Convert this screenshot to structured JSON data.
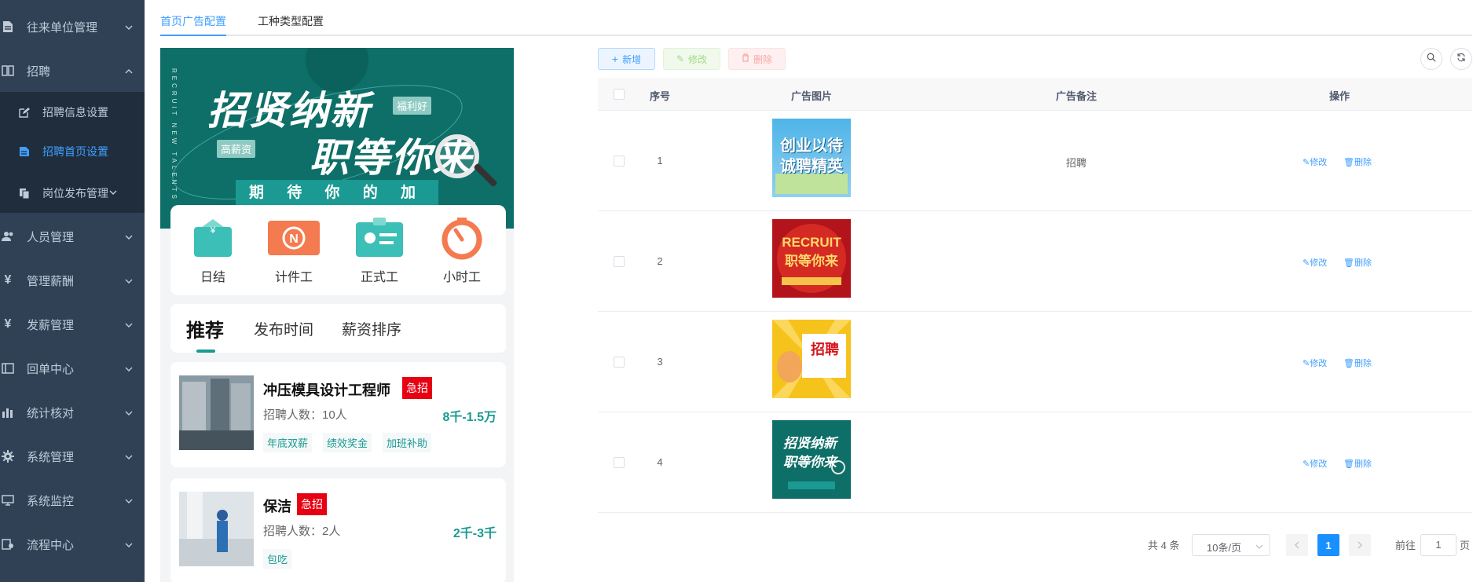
{
  "sidebar": {
    "items": [
      {
        "label": "往来单位管理"
      },
      {
        "label": "招聘"
      },
      {
        "label": "人员管理"
      },
      {
        "label": "管理薪酬"
      },
      {
        "label": "发薪管理"
      },
      {
        "label": "回单中心"
      },
      {
        "label": "统计核对"
      },
      {
        "label": "系统管理"
      },
      {
        "label": "系统监控"
      },
      {
        "label": "流程中心"
      }
    ],
    "sub_items": [
      {
        "label": "招聘信息设置"
      },
      {
        "label": "招聘首页设置"
      },
      {
        "label": "岗位发布管理"
      }
    ]
  },
  "tabs": [
    {
      "label": "首页广告配置"
    },
    {
      "label": "工种类型配置"
    }
  ],
  "preview": {
    "banner": {
      "line1": "招贤纳新",
      "line2": "职等你来",
      "tag1": "福利好",
      "tag2": "高薪资",
      "stripe": "期 待 你 的 加 入 !",
      "side_text": "RECRUIT NEW TALENTS"
    },
    "categories": [
      {
        "label": "日结",
        "icon": "wallet-icon"
      },
      {
        "label": "计件工",
        "icon": "piece-icon"
      },
      {
        "label": "正式工",
        "icon": "badge-icon"
      },
      {
        "label": "小时工",
        "icon": "stopwatch-icon"
      }
    ],
    "sort_tabs": [
      {
        "label": "推荐"
      },
      {
        "label": "发布时间"
      },
      {
        "label": "薪资排序"
      }
    ],
    "jobs": [
      {
        "title": "冲压模具设计工程师",
        "urgent": "急招",
        "count": "招聘人数：10人",
        "salary": "8千-1.5万",
        "tags": [
          "年底双薪",
          "绩效奖金",
          "加班补助"
        ]
      },
      {
        "title": "保洁",
        "urgent": "急招",
        "count": "招聘人数：2人",
        "salary": "2千-3千",
        "tags": [
          "包吃"
        ]
      }
    ]
  },
  "toolbar": {
    "add_label": "新增",
    "edit_label": "修改",
    "delete_label": "删除"
  },
  "table": {
    "columns": [
      "序号",
      "广告图片",
      "广告备注",
      "操作"
    ],
    "rows": [
      {
        "index": "1",
        "note": "招聘",
        "image": "创业以待 诚聘精英"
      },
      {
        "index": "2",
        "note": "",
        "image": "RECRUIT 职等你来"
      },
      {
        "index": "3",
        "note": "",
        "image": "招聘"
      },
      {
        "index": "4",
        "note": "",
        "image": "招贤纳新 职等你来"
      }
    ],
    "edit_action": "修改",
    "delete_action": "删除"
  },
  "pagination": {
    "total": "共 4 条",
    "page_size": "10条/页",
    "current": "1",
    "goto_label": "前往",
    "goto_value": "1",
    "page_suffix": "页"
  },
  "colors": {
    "sidebar": "#304156",
    "accent": "#409eff",
    "teal": "#1a9a92",
    "urgent": "#e60012"
  }
}
